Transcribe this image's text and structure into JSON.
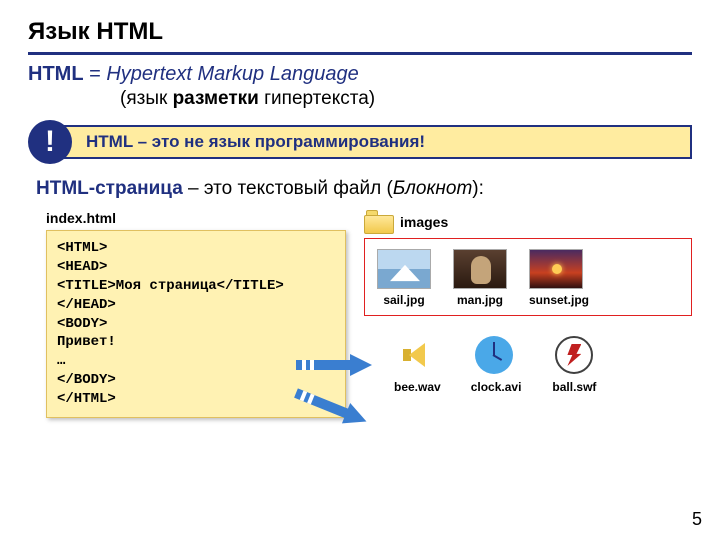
{
  "title": "Язык HTML",
  "line1": {
    "prefix": "HTML",
    "eq": " = ",
    "expansion": "Hypertext Markup Language"
  },
  "line2": {
    "open": "(язык ",
    "bold": "разметки",
    "close": " гипертекста)"
  },
  "alert": {
    "bang": "!",
    "text": "HTML – это не язык программирования!"
  },
  "line3": {
    "a": "HTML-страница",
    "mid": " – это текстовый файл (",
    "i": "Блокнот",
    "end": "):"
  },
  "left": {
    "filename": "index.html",
    "code": "<HTML>\n<HEAD>\n<TITLE>Моя страница</TITLE>\n</HEAD>\n<BODY>\nПривет!\n…\n</BODY>\n</HTML>"
  },
  "folder": "images",
  "images": [
    {
      "name": "sail.jpg"
    },
    {
      "name": "man.jpg"
    },
    {
      "name": "sunset.jpg"
    }
  ],
  "media": [
    {
      "name": "bee.wav"
    },
    {
      "name": "clock.avi"
    },
    {
      "name": "ball.swf"
    }
  ],
  "page": "5"
}
